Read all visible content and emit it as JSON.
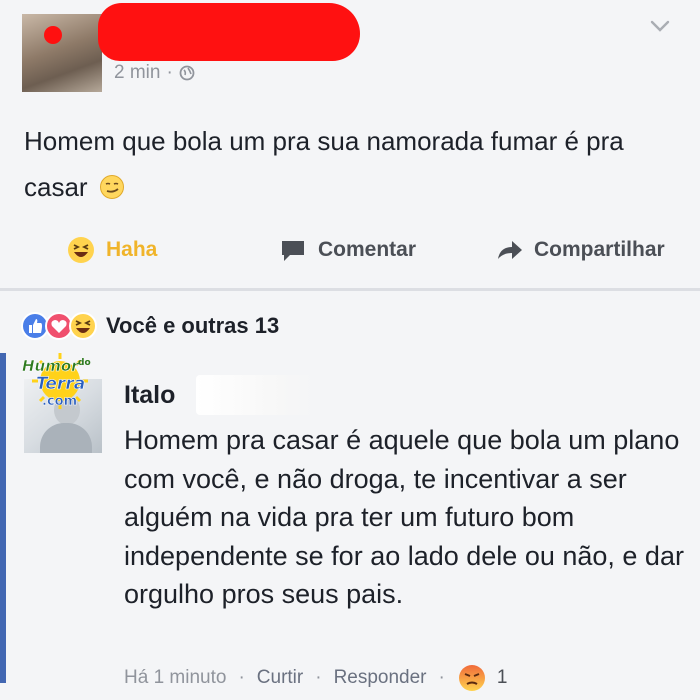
{
  "post": {
    "timestamp": "2 min",
    "separator": "·",
    "privacy_icon": "globe-icon",
    "text": "Homem que bola um pra sua namorada fumar é pra casar",
    "emoji": "smirk-emoji-icon"
  },
  "actions": {
    "haha_label": "Haha",
    "comment_label": "Comentar",
    "share_label": "Compartilhar"
  },
  "reactions": {
    "icons": [
      "like-reaction-icon",
      "love-reaction-icon",
      "haha-reaction-icon"
    ],
    "summary": "Você e outras 13"
  },
  "watermark": {
    "line1": "Humor",
    "line1b": "do",
    "line2": "Terra",
    "line3": ".com"
  },
  "comment": {
    "author": "Italo",
    "text": "Homem pra casar é aquele que bola um plano com você, e não droga, te incentivar a ser alguém na vida pra ter um futuro bom independente se for ao lado dele ou não, e dar orgulho pros seus pais.",
    "time": "Há 1 minuto",
    "like_label": "Curtir",
    "reply_label": "Responder",
    "separator": "·",
    "reaction_icon": "angry-reaction-icon",
    "reaction_count": "1"
  },
  "colors": {
    "haha": "#f0b42a",
    "link_blue": "#4267b2",
    "redaction": "#ff1111"
  }
}
